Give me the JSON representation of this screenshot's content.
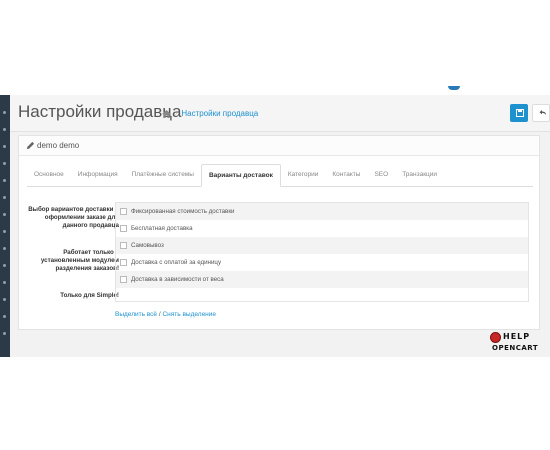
{
  "header": {
    "title": "Настройки продавца",
    "home_icon": "home-icon",
    "breadcrumb": "Настройки продавца"
  },
  "toolbar": {
    "save_icon": "save-icon",
    "back_icon": "back-arrow-icon"
  },
  "panel": {
    "title": "demo demo",
    "title_icon": "pencil-icon"
  },
  "tabs": [
    "Основное",
    "Информация",
    "Платёжные системы",
    "Варианты доставок",
    "Категории",
    "Контакты",
    "SEO",
    "Транзакции"
  ],
  "active_tab": "Варианты доставок",
  "form": {
    "label": "Выбор вариантов доставки в оформлении заказе для данного продавца",
    "note": "Работает только с установленным модулем разделения заказов!",
    "note2": "Только для Simple!",
    "options": [
      "Фиксированная стоимость доставки",
      "Бесплатная доставка",
      "Самовывоз",
      "Доставка с оплатой за единицу",
      "Доставка в зависимости от веса"
    ],
    "select_all": "Выделить всё",
    "separator": "/",
    "deselect_all": "Снять выделение"
  },
  "logo": {
    "line1": "HELP",
    "line2": "OPENCART"
  },
  "colors": {
    "accent": "#1e91cf",
    "sidebar": "#2c3a47",
    "logo_red": "#c62828"
  }
}
